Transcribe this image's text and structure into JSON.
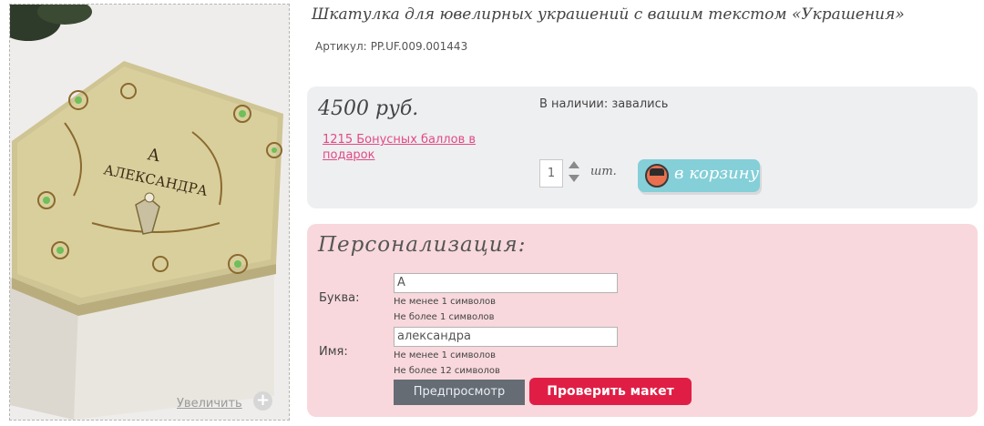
{
  "product": {
    "title": "Шкатулка для ювелирных украшений с вашим текстом «Украшения»",
    "sku_label": "Артикул:",
    "sku_value": "PP.UF.009.001443"
  },
  "image": {
    "engraving_letter": "А",
    "engraving_name": "АЛЕКСАНДРА",
    "zoom_label": "Увеличить",
    "zoom_icon": "plus-circle-icon"
  },
  "purchase": {
    "price": "4500 руб.",
    "bonus_text": "1215 Бонусных баллов в подарок",
    "stock_text": "В наличии: завались",
    "quantity": "1",
    "quantity_unit": "шт.",
    "cart_label": "в корзину"
  },
  "personalization": {
    "title": "Персонализация:",
    "fields": [
      {
        "label": "Буква:",
        "value": "А",
        "hint_min": "Не менее 1 символов",
        "hint_max": "Не более 1 символов"
      },
      {
        "label": "Имя:",
        "value": "александра",
        "hint_min": "Не менее 1 символов",
        "hint_max": "Не более 12 символов"
      }
    ],
    "preview_label": "Предпросмотр",
    "check_label": "Проверить макет"
  },
  "colors": {
    "accent_pink": "#e24a84",
    "cart_teal": "#84cfd8",
    "check_red": "#e01e45",
    "pers_bg": "#f8d8dc",
    "price_bg": "#eeeff1"
  }
}
